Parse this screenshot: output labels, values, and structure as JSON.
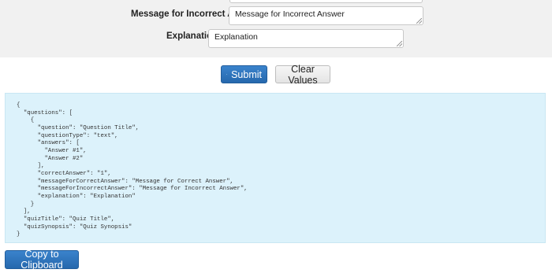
{
  "form": {
    "fields": [
      {
        "label": "Message for Incorrect Answer",
        "value": "Message for Incorrect Answer"
      },
      {
        "label": "Explanation",
        "value": "Explanation"
      }
    ]
  },
  "buttons": {
    "submit_label": "Submit",
    "clear_label": "Clear Values",
    "copy_label": "Copy to Clipboard"
  },
  "icons": {
    "submit": "paper-plane-icon"
  },
  "colors": {
    "primary": "#2e74bb",
    "form_background": "#f1f1f1",
    "output_background": "#dcf2fb"
  },
  "output": {
    "json": "{\n  \"questions\": [\n    {\n      \"question\": \"Question Title\",\n      \"questionType\": \"text\",\n      \"answers\": [\n        \"Answer #1\",\n        \"Answer #2\"\n      ],\n      \"correctAnswer\": \"1\",\n      \"messageForCorrectAnswer\": \"Message for Correct Answer\",\n      \"messageForIncorrectAnswer\": \"Message for Incorrect Answer\",\n      \"explanation\": \"Explanation\"\n    }\n  ],\n  \"quizTitle\": \"Quiz Title\",\n  \"quizSynopsis\": \"Quiz Synopsis\"\n}"
  }
}
